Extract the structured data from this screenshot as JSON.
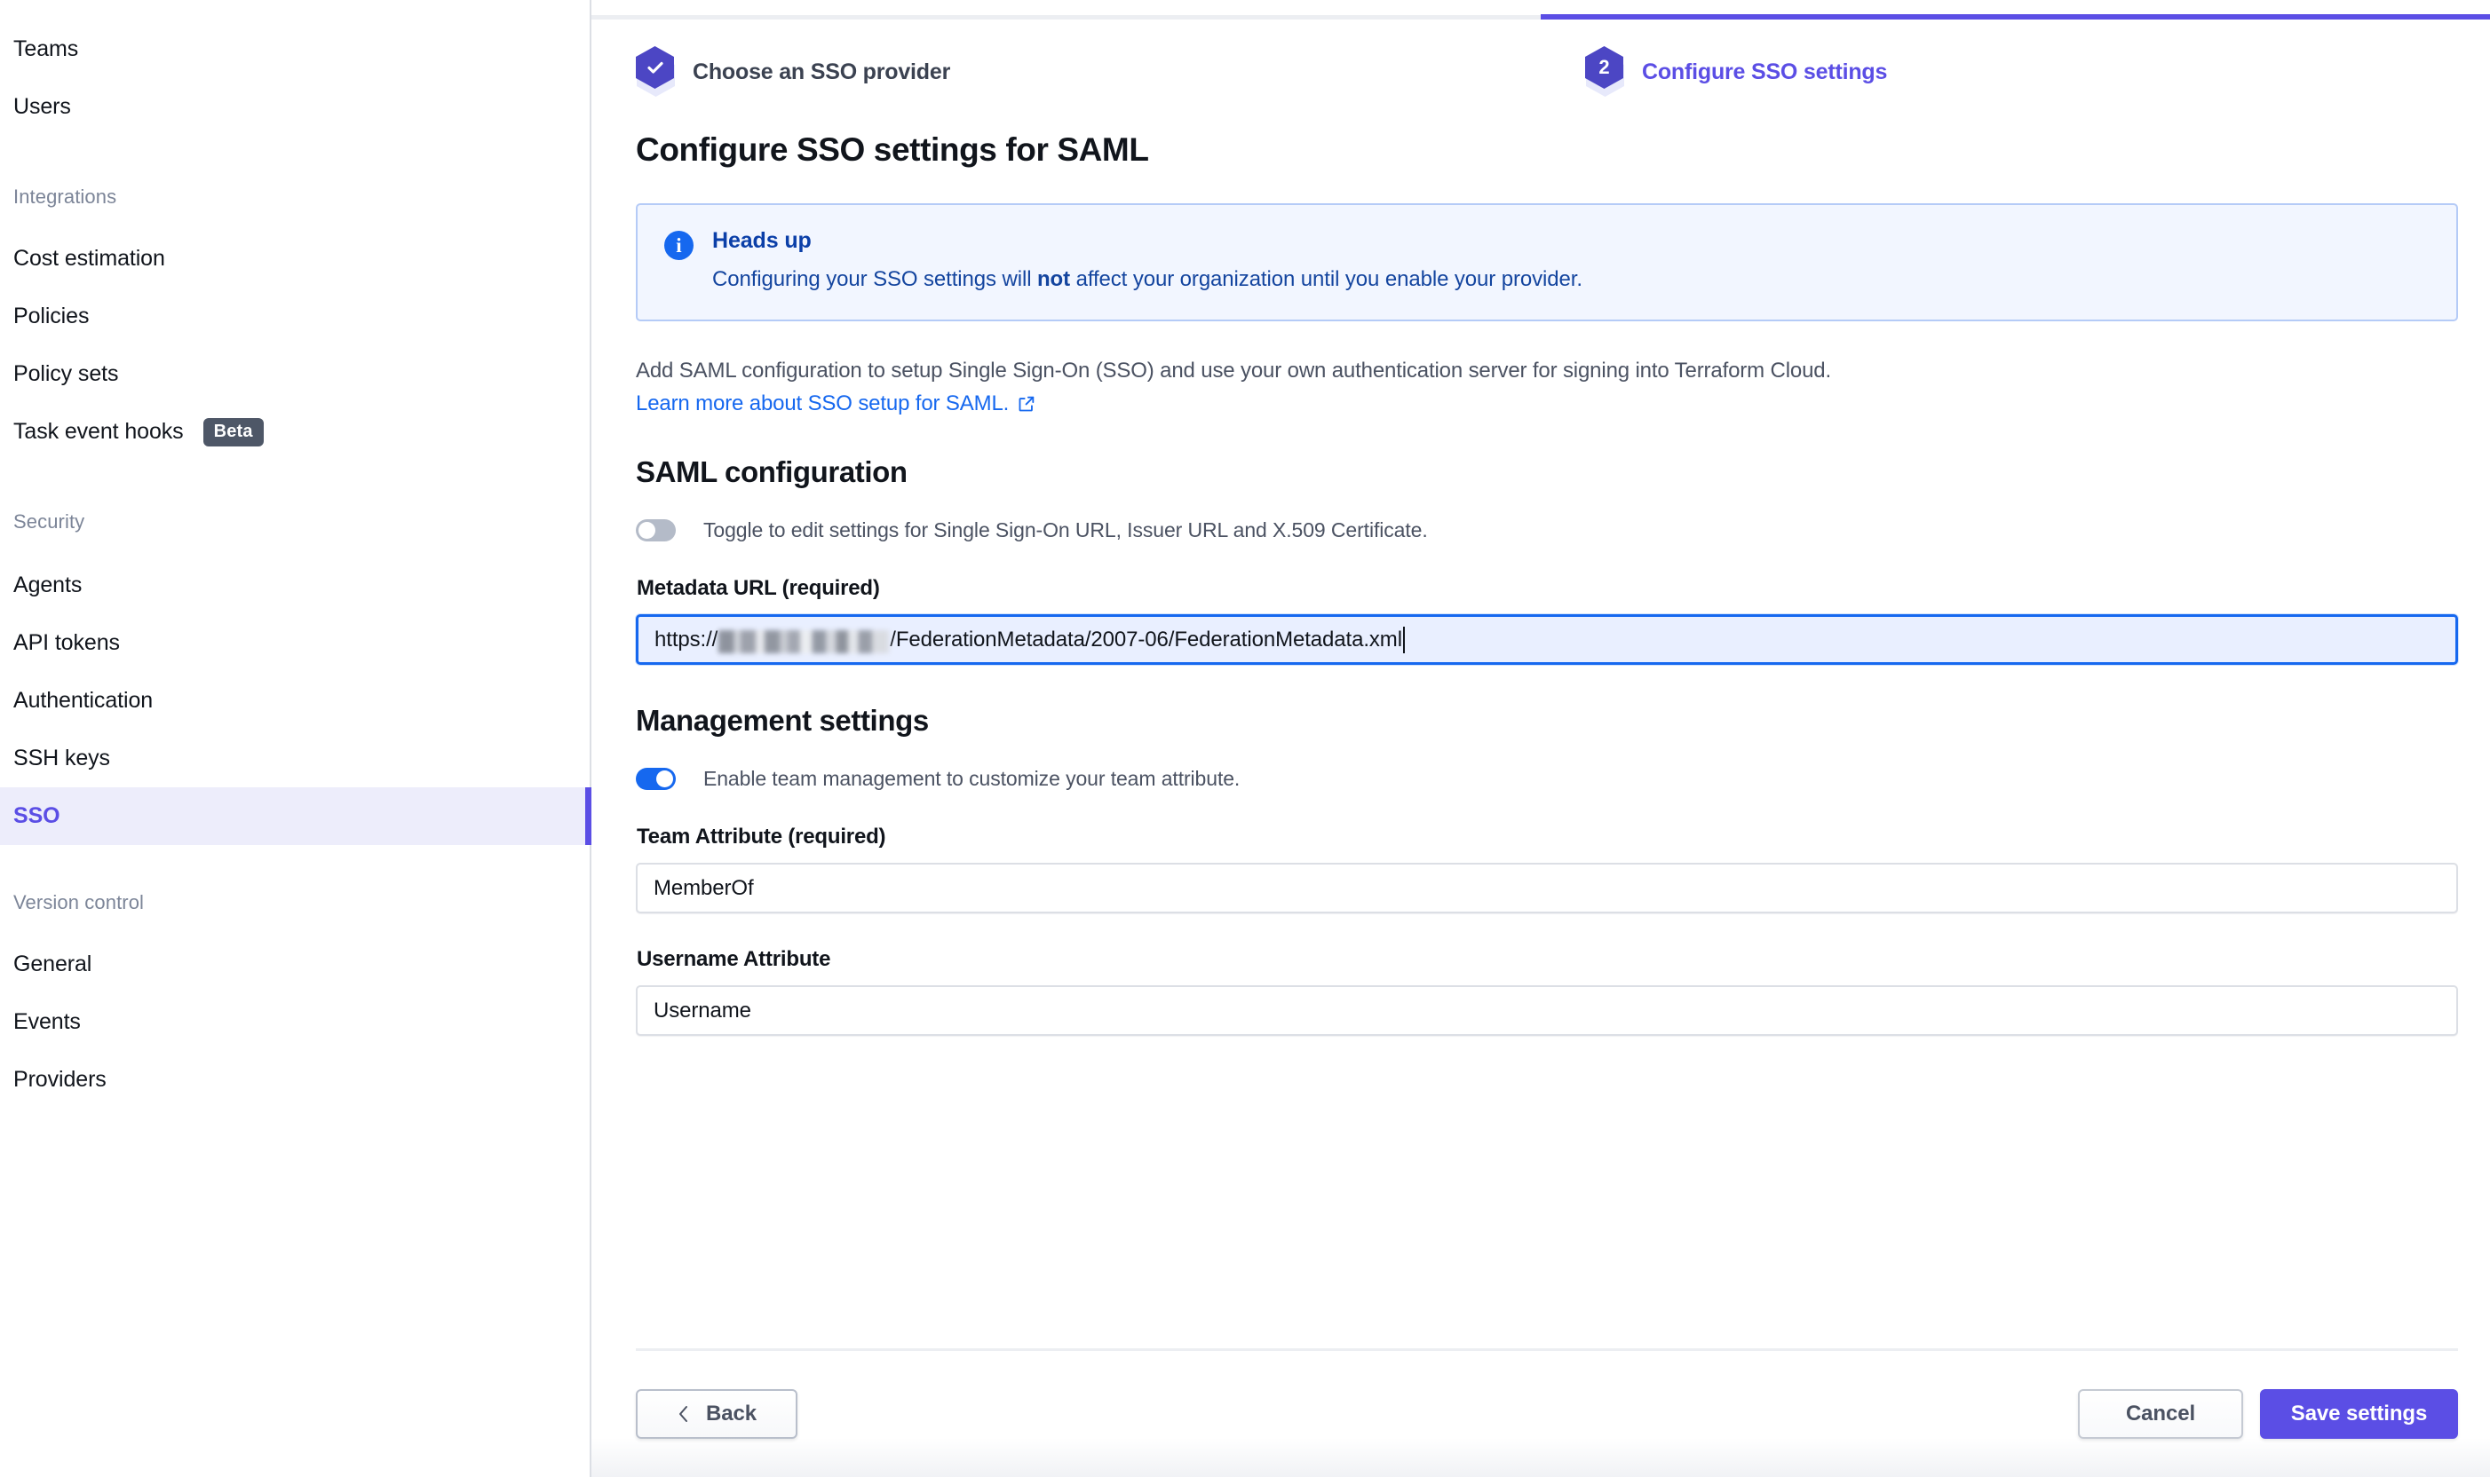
{
  "sidebar": {
    "top_items": [
      {
        "label": "Teams"
      },
      {
        "label": "Users"
      }
    ],
    "sections": [
      {
        "label": "Integrations",
        "items": [
          {
            "label": "Cost estimation",
            "badge": ""
          },
          {
            "label": "Policies",
            "badge": ""
          },
          {
            "label": "Policy sets",
            "badge": ""
          },
          {
            "label": "Task event hooks",
            "badge": "Beta"
          }
        ]
      },
      {
        "label": "Security",
        "items": [
          {
            "label": "Agents",
            "badge": ""
          },
          {
            "label": "API tokens",
            "badge": ""
          },
          {
            "label": "Authentication",
            "badge": ""
          },
          {
            "label": "SSH keys",
            "badge": ""
          },
          {
            "label": "SSO",
            "badge": "",
            "active": true
          }
        ]
      },
      {
        "label": "Version control",
        "items": [
          {
            "label": "General",
            "badge": ""
          },
          {
            "label": "Events",
            "badge": ""
          },
          {
            "label": "Providers",
            "badge": ""
          }
        ]
      }
    ]
  },
  "stepper": {
    "steps": [
      {
        "label": "Choose an SSO provider",
        "state": "complete",
        "marker": "check"
      },
      {
        "label": "Configure SSO settings",
        "state": "current",
        "marker": "2"
      }
    ]
  },
  "main": {
    "page_title": "Configure SSO settings for SAML",
    "alert": {
      "icon": "info-icon",
      "title": "Heads up",
      "text_before": "Configuring your SSO settings will ",
      "text_bold": "not",
      "text_after": " affect your organization until you enable your provider."
    },
    "description": "Add SAML configuration to setup Single Sign-On (SSO) and use your own authentication server for signing into Terraform Cloud.",
    "learn_more_link": "Learn more about SSO setup for SAML.",
    "saml_section": {
      "title": "SAML configuration",
      "toggle_label": "Toggle to edit settings for Single Sign-On URL, Issuer URL and X.509 Certificate.",
      "toggle_state": "off",
      "metadata_label": "Metadata URL (required)",
      "metadata_value_prefix": "https://",
      "metadata_value_suffix": "/FederationMetadata/2007-06/FederationMetadata.xml",
      "metadata_host_redacted": true
    },
    "management_section": {
      "title": "Management settings",
      "toggle_label": "Enable team management to customize your team attribute.",
      "toggle_state": "on",
      "team_attribute_label": "Team Attribute (required)",
      "team_attribute_value": "MemberOf",
      "username_attribute_label": "Username Attribute",
      "username_attribute_value": "Username"
    },
    "footer": {
      "back_label": "Back",
      "cancel_label": "Cancel",
      "save_label": "Save settings"
    }
  },
  "colors": {
    "accent_purple": "#5b4ee5",
    "info_blue": "#1668ef",
    "alert_bg": "#f2f6ff",
    "active_nav_bg": "#ededfb",
    "beta_badge_bg": "#4e5767"
  }
}
